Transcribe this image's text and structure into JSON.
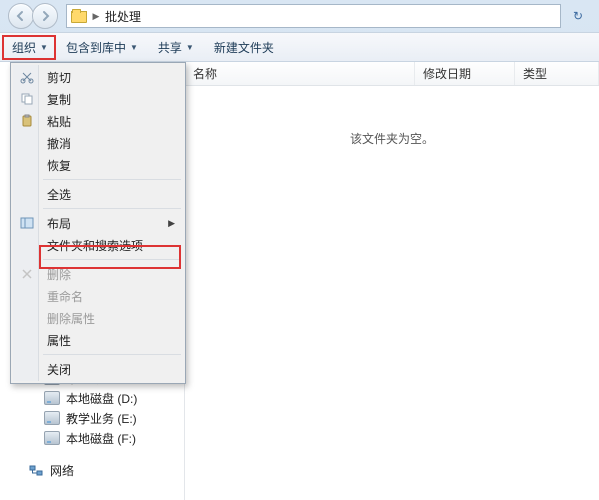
{
  "title_path": "批处理",
  "cmdbar": {
    "organize": "组织",
    "include": "包含到库中",
    "share": "共享",
    "newfolder": "新建文件夹"
  },
  "columns": {
    "name": "名称",
    "date": "修改日期",
    "type": "类型"
  },
  "empty_message": "该文件夹为空。",
  "menu": {
    "cut": "剪切",
    "copy": "复制",
    "paste": "粘贴",
    "undo": "撤消",
    "redo": "恢复",
    "select_all": "全选",
    "layout": "布局",
    "folder_options": "文件夹和搜索选项",
    "delete": "删除",
    "rename": "重命名",
    "remove_props": "删除属性",
    "properties": "属性",
    "close": "关闭"
  },
  "sidebar": {
    "items": [
      {
        "label": "本地磁盘 (D:)"
      },
      {
        "label": "教学业务 (E:)"
      },
      {
        "label": "本地磁盘 (F:)"
      }
    ],
    "truncated_top": "本地磁盘",
    "network": "网络"
  }
}
